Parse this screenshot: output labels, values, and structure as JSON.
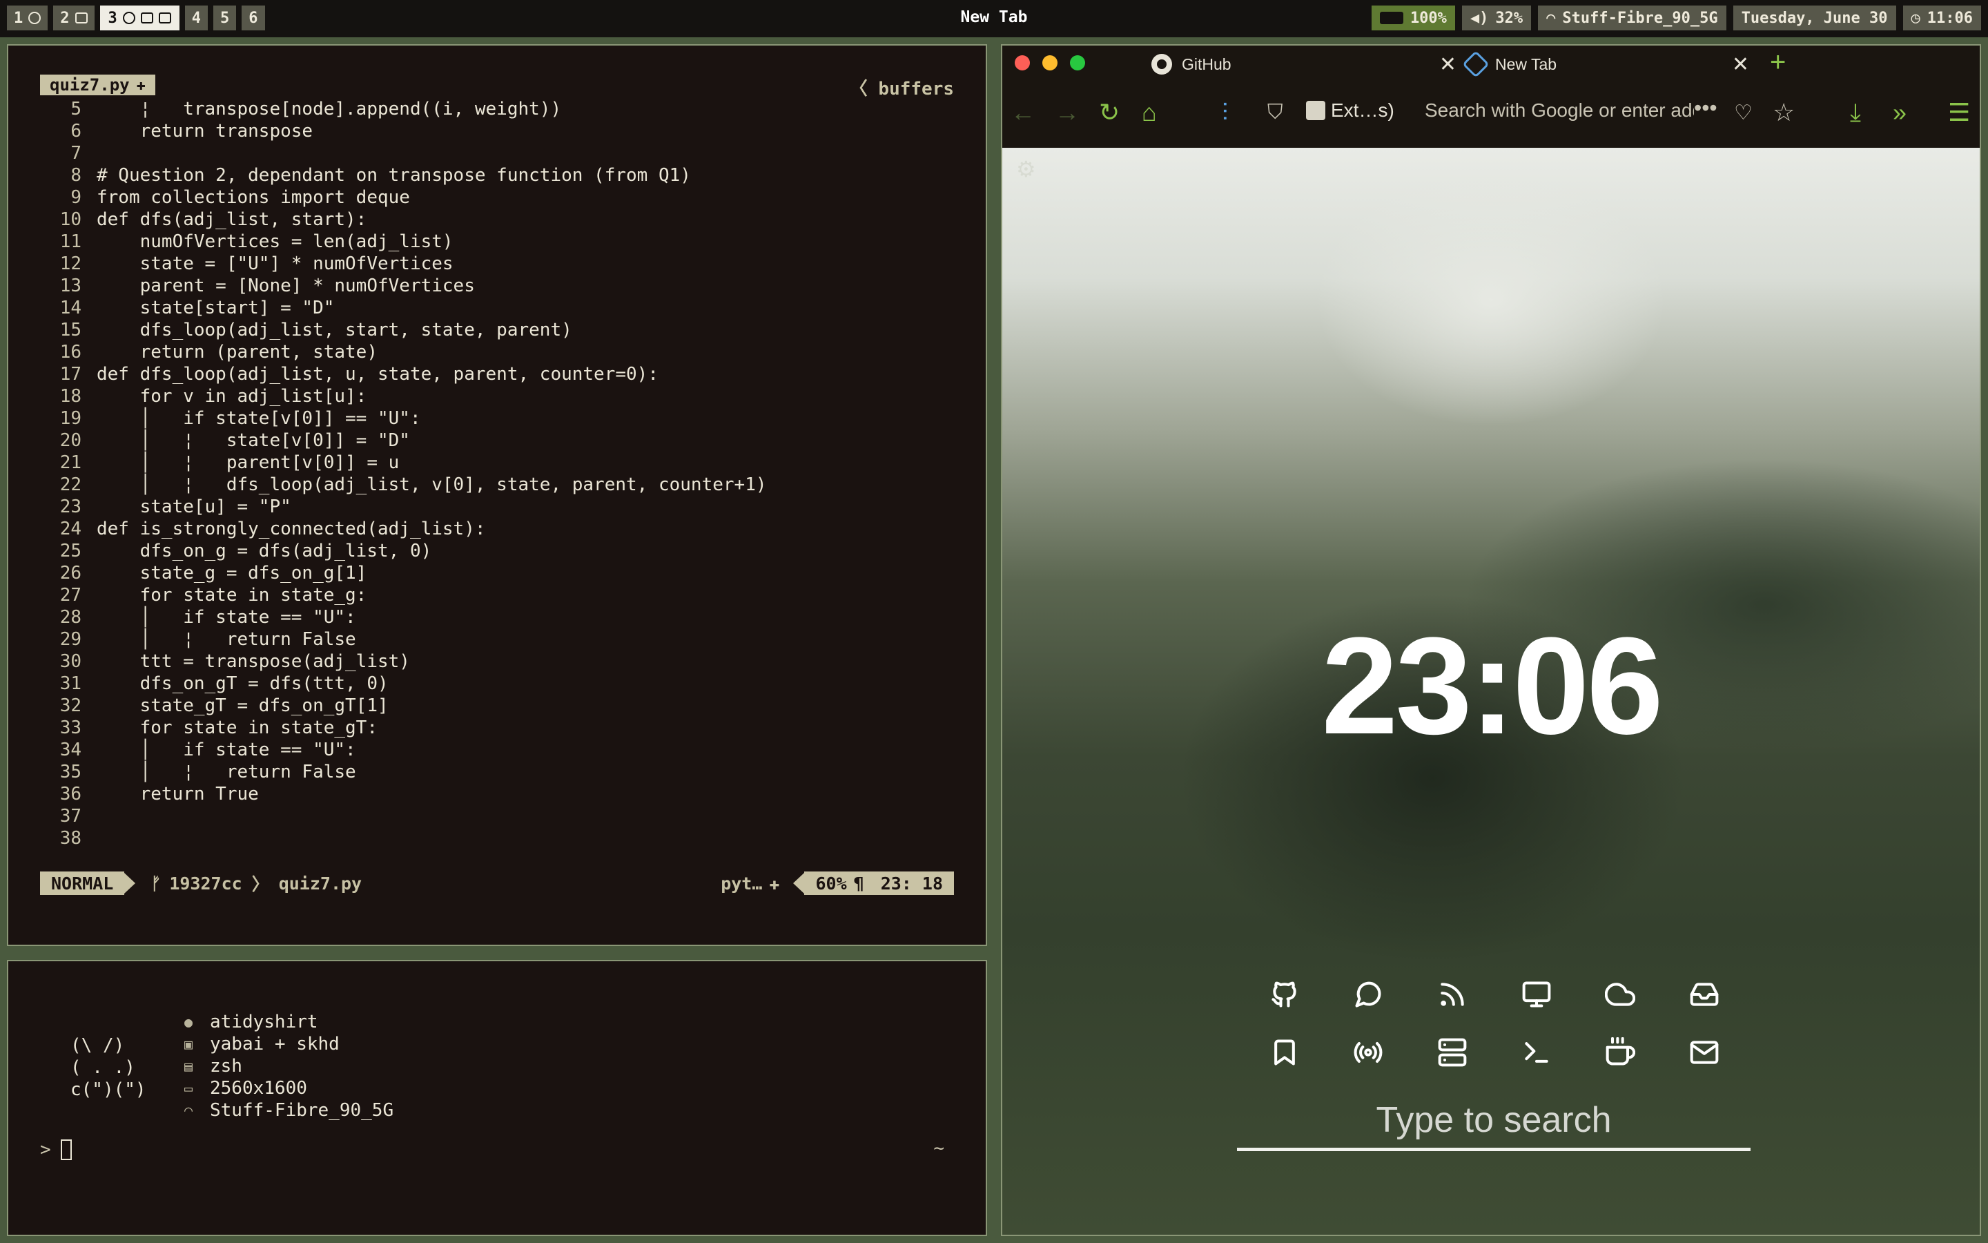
{
  "topbar": {
    "workspaces": [
      {
        "num": "1",
        "active": false
      },
      {
        "num": "2",
        "active": false
      },
      {
        "num": "3",
        "active": true
      },
      {
        "num": "4",
        "active": false
      },
      {
        "num": "5",
        "active": false
      },
      {
        "num": "6",
        "active": false
      }
    ],
    "window_title": "New Tab",
    "battery": "100%",
    "volume": "32%",
    "wifi": "Stuff-Fibre_90_5G",
    "date": "Tuesday, June 30",
    "time": "11:06"
  },
  "editor": {
    "file_tab": "quiz7.py",
    "buffers_label": "buffers",
    "lines": [
      {
        "n": "5",
        "t": "    ¦   transpose[node].append((i, weight))"
      },
      {
        "n": "6",
        "t": "    return transpose"
      },
      {
        "n": "7",
        "t": ""
      },
      {
        "n": "8",
        "t": "# Question 2, dependant on transpose function (from Q1)"
      },
      {
        "n": "9",
        "t": "from collections import deque"
      },
      {
        "n": "10",
        "t": "def dfs(adj_list, start):"
      },
      {
        "n": "11",
        "t": "    numOfVertices = len(adj_list)"
      },
      {
        "n": "12",
        "t": "    state = [\"U\"] * numOfVertices"
      },
      {
        "n": "13",
        "t": "    parent = [None] * numOfVertices"
      },
      {
        "n": "14",
        "t": "    state[start] = \"D\""
      },
      {
        "n": "15",
        "t": "    dfs_loop(adj_list, start, state, parent)"
      },
      {
        "n": "16",
        "t": "    return (parent, state)"
      },
      {
        "n": "17",
        "t": "def dfs_loop(adj_list, u, state, parent, counter=0):"
      },
      {
        "n": "18",
        "t": "    for v in adj_list[u]:"
      },
      {
        "n": "19",
        "t": "    │   if state[v[0]] == \"U\":"
      },
      {
        "n": "20",
        "t": "    │   ¦   state[v[0]] = \"D\""
      },
      {
        "n": "21",
        "t": "    │   ¦   parent[v[0]] = u"
      },
      {
        "n": "22",
        "t": "    │   ¦   dfs_loop(adj_list, v[0], state, parent, counter+1)"
      },
      {
        "n": "23",
        "t": "    state[u] = \"P\""
      },
      {
        "n": "24",
        "t": "def is_strongly_connected(adj_list):"
      },
      {
        "n": "25",
        "t": "    dfs_on_g = dfs(adj_list, 0)"
      },
      {
        "n": "26",
        "t": "    state_g = dfs_on_g[1]"
      },
      {
        "n": "27",
        "t": "    for state in state_g:"
      },
      {
        "n": "28",
        "t": "    │   if state == \"U\":"
      },
      {
        "n": "29",
        "t": "    │   ¦   return False"
      },
      {
        "n": "30",
        "t": "    ttt = transpose(adj_list)"
      },
      {
        "n": "31",
        "t": "    dfs_on_gT = dfs(ttt, 0)"
      },
      {
        "n": "32",
        "t": "    state_gT = dfs_on_gT[1]"
      },
      {
        "n": "33",
        "t": "    for state in state_gT:"
      },
      {
        "n": "34",
        "t": "    │   if state == \"U\":"
      },
      {
        "n": "35",
        "t": "    │   ¦   return False"
      },
      {
        "n": "36",
        "t": "    return True"
      },
      {
        "n": "37",
        "t": ""
      },
      {
        "n": "38",
        "t": ""
      }
    ],
    "status": {
      "mode": "NORMAL",
      "branch": "19327cc",
      "file": "quiz7.py",
      "filetype": "pyt…",
      "percent": "60%",
      "paragraph": "¶",
      "position": "23: 18"
    }
  },
  "terminal": {
    "ascii": "(\\ /)\n( . .)\nc(\")(\")",
    "info": [
      {
        "icon": "apple-icon",
        "glyph": "●",
        "text": "atidyshirt"
      },
      {
        "icon": "windows-icon",
        "glyph": "▣",
        "text": "yabai + skhd"
      },
      {
        "icon": "terminal-icon",
        "glyph": "▤",
        "text": "zsh"
      },
      {
        "icon": "monitor-icon",
        "glyph": "▭",
        "text": "2560x1600"
      },
      {
        "icon": "wifi-icon",
        "glyph": "◠",
        "text": "Stuff-Fibre_90_5G"
      }
    ],
    "prompt": ">",
    "cwd": "~"
  },
  "browser": {
    "tabs": [
      {
        "label": "GitHub"
      },
      {
        "label": "New Tab"
      }
    ],
    "extensions_label": "Ext…s)",
    "url_placeholder": "Search with Google or enter address",
    "dots": "•••",
    "clock": "23:06",
    "search_placeholder": "Type to search",
    "shortcut_icons": [
      "github-icon",
      "chat-icon",
      "rss-icon",
      "monitor-icon",
      "cloud-icon",
      "inbox-icon",
      "bookmark-icon",
      "broadcast-icon",
      "server-icon",
      "terminal-icon",
      "coffee-icon",
      "mail-icon"
    ],
    "colors": {
      "accent": "#8bc34a",
      "background": "#1a1510"
    }
  }
}
